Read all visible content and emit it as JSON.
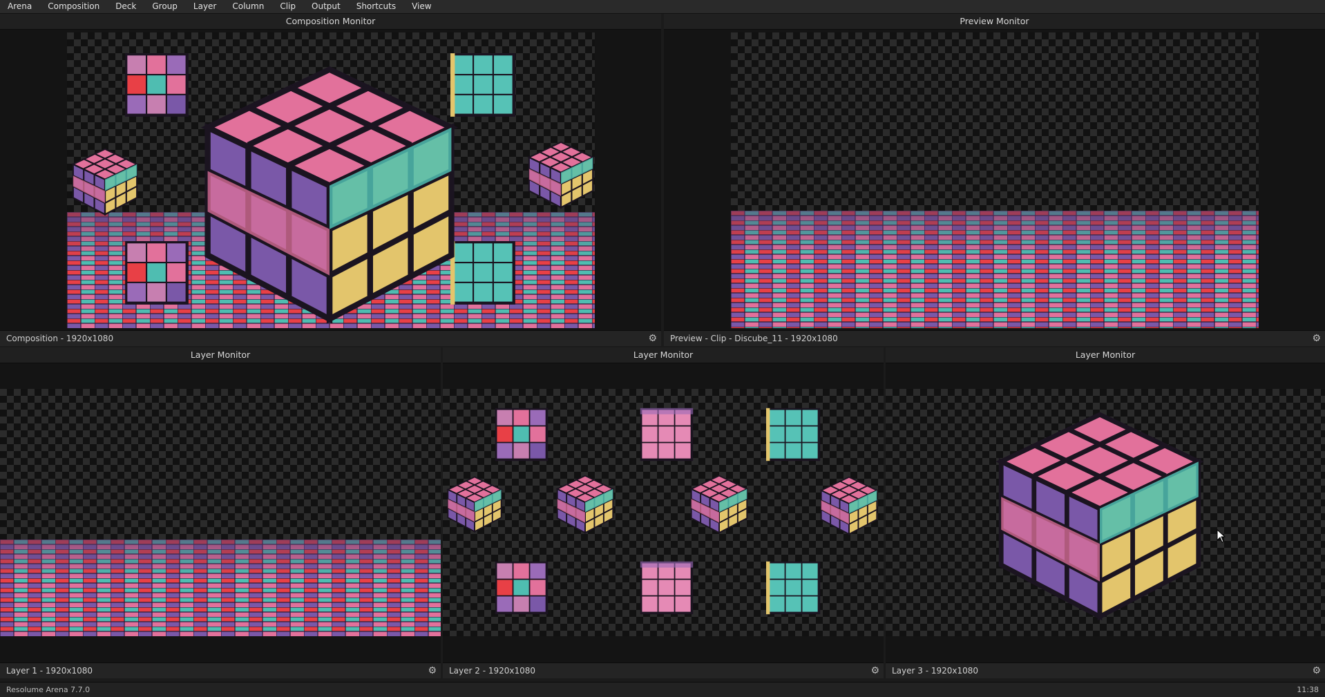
{
  "menu": [
    "Arena",
    "Composition",
    "Deck",
    "Group",
    "Layer",
    "Column",
    "Clip",
    "Output",
    "Shortcuts",
    "View"
  ],
  "composition_monitor": {
    "title": "Composition Monitor",
    "footer": "Composition - 1920x1080",
    "settings_icon": "gear-icon"
  },
  "preview_monitor": {
    "title": "Preview Monitor",
    "footer": "Preview - Clip - Discube_11 - 1920x1080",
    "settings_icon": "gear-icon"
  },
  "layer_monitors": [
    {
      "title": "Layer Monitor",
      "footer": "Layer 1 - 1920x1080",
      "settings_icon": "gear-icon"
    },
    {
      "title": "Layer Monitor",
      "footer": "Layer 2 - 1920x1080",
      "settings_icon": "gear-icon"
    },
    {
      "title": "Layer Monitor",
      "footer": "Layer 3 - 1920x1080",
      "settings_icon": "gear-icon"
    }
  ],
  "status": {
    "app_version": "Resolume Arena 7.7.0",
    "time": "11:38"
  },
  "colors": {
    "pink": "#e2719b",
    "purple": "#7a58a8",
    "teal": "#4fbdb1",
    "gold": "#e3c56c",
    "red": "#e84046",
    "panel": "#202020"
  }
}
